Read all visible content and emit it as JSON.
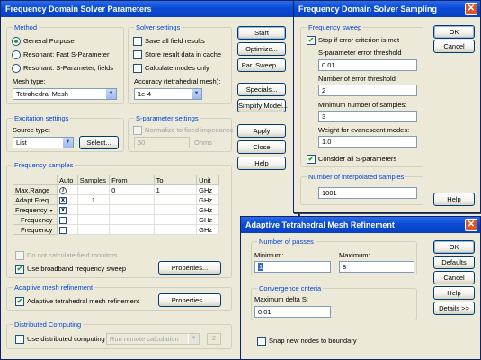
{
  "solver": {
    "title": "Frequency Domain Solver Parameters",
    "method": {
      "title": "Method",
      "options": [
        "General Purpose",
        "Resonant: Fast S-Parameter",
        "Resonant: S-Parameter, fields"
      ],
      "selected": 0,
      "mesh_type_label": "Mesh type:",
      "mesh_type_value": "Tetrahedral Mesh"
    },
    "settings": {
      "title": "Solver settings",
      "save_all": "Save all field results",
      "store_cache": "Store result data in cache",
      "calc_modes": "Calculate modes only",
      "accuracy_label": "Accuracy (tetrahedral mesh):",
      "accuracy_value": "1e-4"
    },
    "buttons": {
      "start": "Start",
      "optimize": "Optimize...",
      "par_sweep": "Par. Sweep...",
      "specials": "Specials...",
      "simplify": "Simplify Model...",
      "apply": "Apply",
      "close": "Close",
      "help": "Help"
    },
    "excitation": {
      "title": "Excitation settings",
      "source_label": "Source type:",
      "source_value": "List",
      "select_btn": "Select..."
    },
    "sparam": {
      "title": "S-parameter settings",
      "normalize": "Normalize to fixed impedance",
      "value": "50",
      "unit": "Ohms"
    },
    "freq_samples": {
      "title": "Frequency samples",
      "headers": [
        "",
        "Auto",
        "Samples",
        "From",
        "To",
        "Unit"
      ],
      "rows": [
        {
          "label": "Max.Range",
          "auto": "info",
          "samples": "",
          "from": "0",
          "to": "1",
          "unit": "GHz"
        },
        {
          "label": "Adapt.Freq.",
          "auto": "x",
          "samples": "1",
          "from": "",
          "to": "",
          "unit": "GHz"
        },
        {
          "label": "Frequency",
          "auto": "x",
          "samples": "",
          "from": "",
          "to": "",
          "unit": "GHz"
        },
        {
          "label": "Frequency",
          "auto": "",
          "samples": "",
          "from": "",
          "to": "",
          "unit": "GHz"
        },
        {
          "label": "Frequency",
          "auto": "",
          "samples": "",
          "from": "",
          "to": "",
          "unit": "GHz"
        }
      ],
      "no_field_monitors": "Do not calculate field monitors",
      "broadband": "Use broadband frequency sweep",
      "properties_btn": "Properties..."
    },
    "adaptive": {
      "title": "Adaptive mesh refinement",
      "label": "Adaptive tetrahedral mesh refinement",
      "properties_btn": "Properties..."
    },
    "distributed": {
      "title": "Distributed Computing",
      "label": "Use distributed computing",
      "mode_value": "Run remote calculation",
      "count": "2"
    }
  },
  "sampling": {
    "title": "Frequency Domain Solver Sampling",
    "sweep_title": "Frequency sweep",
    "stop_if": "Stop if error criterion is met",
    "sparam_threshold_label": "S-parameter error threshold",
    "sparam_threshold_value": "0.01",
    "num_threshold_label": "Number of error threshold",
    "num_threshold_value": "2",
    "min_samples_label": "Minimum number of samples:",
    "min_samples_value": "3",
    "weight_label": "Weight for evanescent modes:",
    "weight_value": "1.0",
    "consider_all": "Consider all S-parameters",
    "interp_title": "Number of interpolated samples",
    "interp_value": "1001",
    "ok": "OK",
    "cancel": "Cancel",
    "help": "Help"
  },
  "refine": {
    "title": "Adaptive Tetrahedral Mesh Refinement",
    "passes_title": "Number of passes",
    "min_label": "Minimum:",
    "min_value": "1",
    "max_label": "Maximum:",
    "max_value": "8",
    "conv_title": "Convergence criteria",
    "delta_label": "Maximum delta S:",
    "delta_value": "0.01",
    "snap": "Snap new nodes to boundary",
    "ok": "OK",
    "defaults": "Defaults",
    "cancel": "Cancel",
    "help": "Help",
    "details": "Details >>"
  }
}
